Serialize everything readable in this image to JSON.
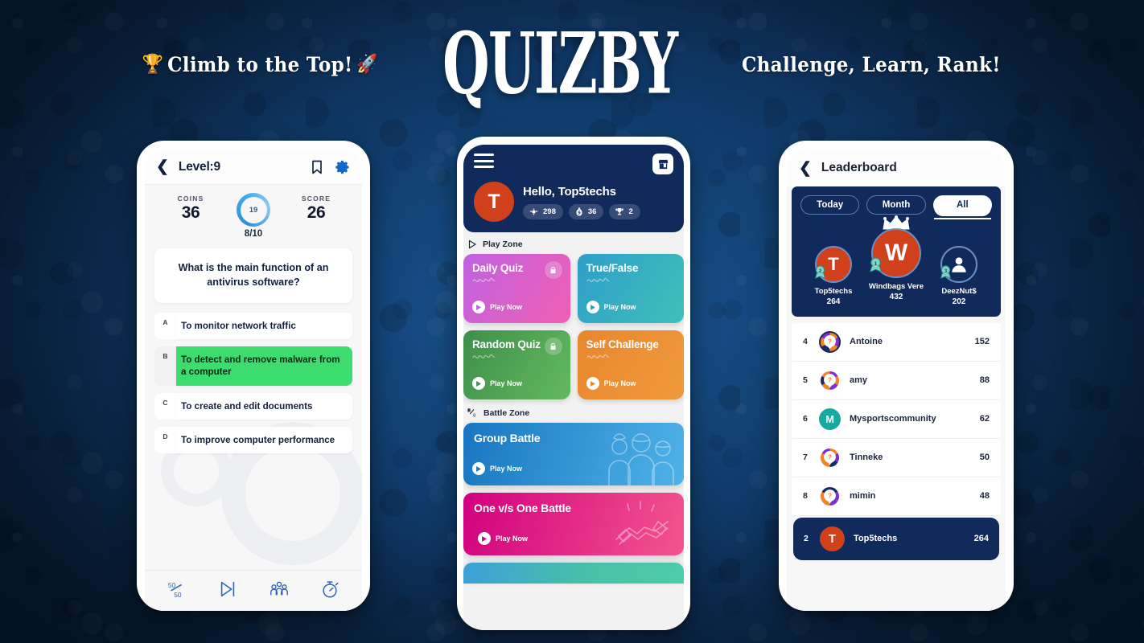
{
  "header": {
    "tagline_left": "Climb to the Top!",
    "tagline_left_emoji1": "🏆",
    "tagline_left_emoji2": "🚀",
    "brand": "QUIZBY",
    "tagline_right": "Challenge, Learn, Rank!"
  },
  "quiz": {
    "back_icon": "chevron-left-icon",
    "title": "Level:9",
    "bookmark_icon": "bookmark-icon",
    "settings_icon": "gear-icon",
    "coins_label": "COINS",
    "coins_value": "36",
    "score_label": "SCORE",
    "score_value": "26",
    "timer_value": "19",
    "progress": "8/10",
    "question": "What is the main function of an antivirus software?",
    "answers": [
      {
        "letter": "A",
        "text": "To monitor network traffic",
        "correct": false
      },
      {
        "letter": "B",
        "text": "To detect and remove malware from a computer",
        "correct": true
      },
      {
        "letter": "C",
        "text": "To create and edit documents",
        "correct": false
      },
      {
        "letter": "D",
        "text": "To improve computer performance",
        "correct": false
      }
    ],
    "lifelines": [
      {
        "name": "fifty-fifty-icon",
        "label": "50/50"
      },
      {
        "name": "skip-question-icon",
        "label": "Skip"
      },
      {
        "name": "ask-audience-icon",
        "label": "Audience"
      },
      {
        "name": "extra-time-icon",
        "label": "Extra Time"
      }
    ],
    "correct_color": "#3ddc6e"
  },
  "home": {
    "menu_icon": "hamburger-menu-icon",
    "shop_icon": "store-icon",
    "avatar_initial": "T",
    "greeting": "Hello, Top5techs",
    "stats": [
      {
        "icon": "rank-badge-icon",
        "value": "298"
      },
      {
        "icon": "coin-bag-icon",
        "value": "36"
      },
      {
        "icon": "trophy-icon",
        "value": "2"
      }
    ],
    "play_zone_label": "Play Zone",
    "play_zone_icon": "play-outline-icon",
    "quiz_cards": [
      {
        "title": "Daily Quiz",
        "cta": "Play Now",
        "locked": true,
        "color_from": "#c062e0",
        "color_to": "#f05fb4"
      },
      {
        "title": "True/False",
        "cta": "Play Now",
        "locked": false,
        "color_from": "#2e9ec9",
        "color_to": "#3fc0b9"
      },
      {
        "title": "Random Quiz",
        "cta": "Play Now",
        "locked": true,
        "color_from": "#3e8f4a",
        "color_to": "#63b95f"
      },
      {
        "title": "Self Challenge",
        "cta": "Play Now",
        "locked": false,
        "color_from": "#e8862e",
        "color_to": "#ef9a3c"
      }
    ],
    "battle_zone_label": "Battle Zone",
    "battle_zone_icon": "versus-icon",
    "battle_cards": [
      {
        "title": "Group Battle",
        "cta": "Play Now",
        "art": "group-people-icon",
        "color_from": "#1876c0",
        "color_to": "#4fb3e8"
      },
      {
        "title": "One v/s One Battle",
        "cta": "Play Now",
        "art": "handshake-icon",
        "color_from": "#d1007e",
        "color_to": "#f4558f"
      }
    ]
  },
  "leaderboard": {
    "back_icon": "chevron-left-icon",
    "title": "Leaderboard",
    "tabs": [
      {
        "label": "Today",
        "active": false
      },
      {
        "label": "Month",
        "active": false
      },
      {
        "label": "All",
        "active": true
      }
    ],
    "podium": [
      {
        "place": "2",
        "initial": "T",
        "name": "Top5techs",
        "score": "264",
        "avatar": "initial"
      },
      {
        "place": "1",
        "initial": "W",
        "name": "Windbags Vere",
        "score": "432",
        "avatar": "initial",
        "crown": true
      },
      {
        "place": "3",
        "initial": "",
        "name": "DeezNut$",
        "score": "202",
        "avatar": "person-outline-icon"
      }
    ],
    "rows": [
      {
        "rank": "4",
        "name": "Antoine",
        "score": "152",
        "avatar": "question-ring-icon"
      },
      {
        "rank": "5",
        "name": "amy",
        "score": "88",
        "avatar": "question-ring-icon"
      },
      {
        "rank": "6",
        "name": "Mysportscommunity",
        "score": "62",
        "avatar": "initial",
        "initial": "M",
        "color": "#19a8a0"
      },
      {
        "rank": "7",
        "name": "Tinneke",
        "score": "50",
        "avatar": "question-ring-icon"
      },
      {
        "rank": "8",
        "name": "mimin",
        "score": "48",
        "avatar": "question-ring-icon"
      }
    ],
    "me_row": {
      "rank": "2",
      "name": "Top5techs",
      "score": "264",
      "initial": "T",
      "color": "#d0401a"
    }
  },
  "colors": {
    "background_navy": "#0e3460",
    "panel_navy": "#102a5c",
    "accent_orange": "#d0401a"
  }
}
